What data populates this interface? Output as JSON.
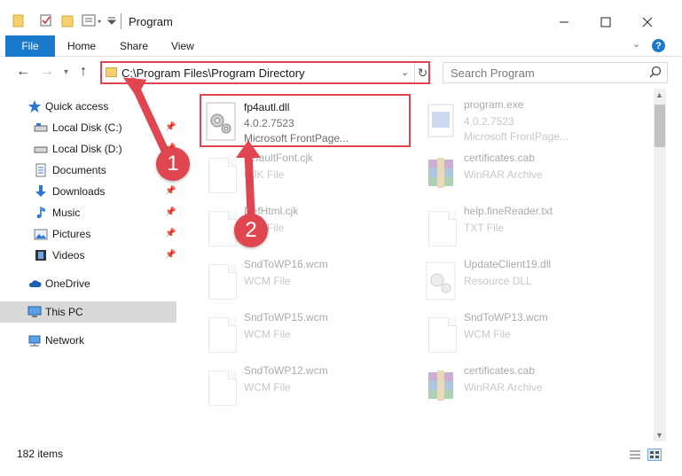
{
  "titlebar": {
    "title": "Program",
    "buttons": {
      "minimize": "minimize",
      "maximize": "maximize",
      "close": "close"
    }
  },
  "ribbon": {
    "tabs": [
      {
        "label": "File",
        "active": true
      },
      {
        "label": "Home"
      },
      {
        "label": "Share"
      },
      {
        "label": "View"
      }
    ],
    "help": "?"
  },
  "nav": {
    "address": "C:\\Program Files\\Program Directory",
    "search_placeholder": "Search Program"
  },
  "sidebar": {
    "items": [
      {
        "label": "Quick access",
        "icon": "star-icon",
        "pinned": false
      },
      {
        "label": "Local Disk (C:)",
        "icon": "drive-icon",
        "pinned": true
      },
      {
        "label": "Local Disk (D:)",
        "icon": "drive-icon",
        "pinned": true
      },
      {
        "label": "Documents",
        "icon": "documents-icon",
        "pinned": true
      },
      {
        "label": "Downloads",
        "icon": "download-icon",
        "pinned": true
      },
      {
        "label": "Music",
        "icon": "music-icon",
        "pinned": true
      },
      {
        "label": "Pictures",
        "icon": "pictures-icon",
        "pinned": true
      },
      {
        "label": "Videos",
        "icon": "videos-icon",
        "pinned": true
      },
      {
        "label": "OneDrive",
        "icon": "cloud-icon"
      },
      {
        "label": "This PC",
        "icon": "pc-icon",
        "selected": true
      },
      {
        "label": "Network",
        "icon": "network-icon"
      }
    ]
  },
  "files": [
    {
      "name": "fp4autl.dll",
      "line1": "4.0.2.7523",
      "line2": "Microsoft FrontPage...",
      "icon": "dll-gear-icon",
      "highlighted": true
    },
    {
      "name": "program.exe",
      "line1": "4.0.2.7523",
      "line2": "Microsoft FrontPage...",
      "icon": "exe-icon"
    },
    {
      "name": "defaultFont.cjk",
      "line1": "CJK File",
      "line2": "",
      "icon": "file-icon"
    },
    {
      "name": "certificates.cab",
      "line1": "WinRAR Archive",
      "line2": "",
      "icon": "winrar-icon"
    },
    {
      "name": "DefHtml.cjk",
      "line1": "CJK File",
      "line2": "",
      "icon": "file-icon"
    },
    {
      "name": "help.fineReader.txt",
      "line1": "TXT File",
      "line2": "",
      "icon": "file-icon"
    },
    {
      "name": "SndToWP16.wcm",
      "line1": "WCM File",
      "line2": "",
      "icon": "file-icon"
    },
    {
      "name": "UpdateClient19.dll",
      "line1": "Resource DLL",
      "line2": "",
      "icon": "dll-icon"
    },
    {
      "name": "SndToWP15.wcm",
      "line1": "WCM File",
      "line2": "",
      "icon": "file-icon"
    },
    {
      "name": "SndToWP13.wcm",
      "line1": "WCM File",
      "line2": "",
      "icon": "file-icon"
    },
    {
      "name": "SndToWP12.wcm",
      "line1": "WCM File",
      "line2": "",
      "icon": "file-icon"
    },
    {
      "name": "certificates.cab",
      "line1": "WinRAR Archive",
      "line2": "",
      "icon": "winrar-icon"
    }
  ],
  "status": {
    "count": "182 items"
  },
  "annotations": {
    "step1": "1",
    "step2": "2"
  },
  "colors": {
    "accent": "#1979ca",
    "highlight": "#e0464f",
    "selected": "#d9d9d9"
  }
}
